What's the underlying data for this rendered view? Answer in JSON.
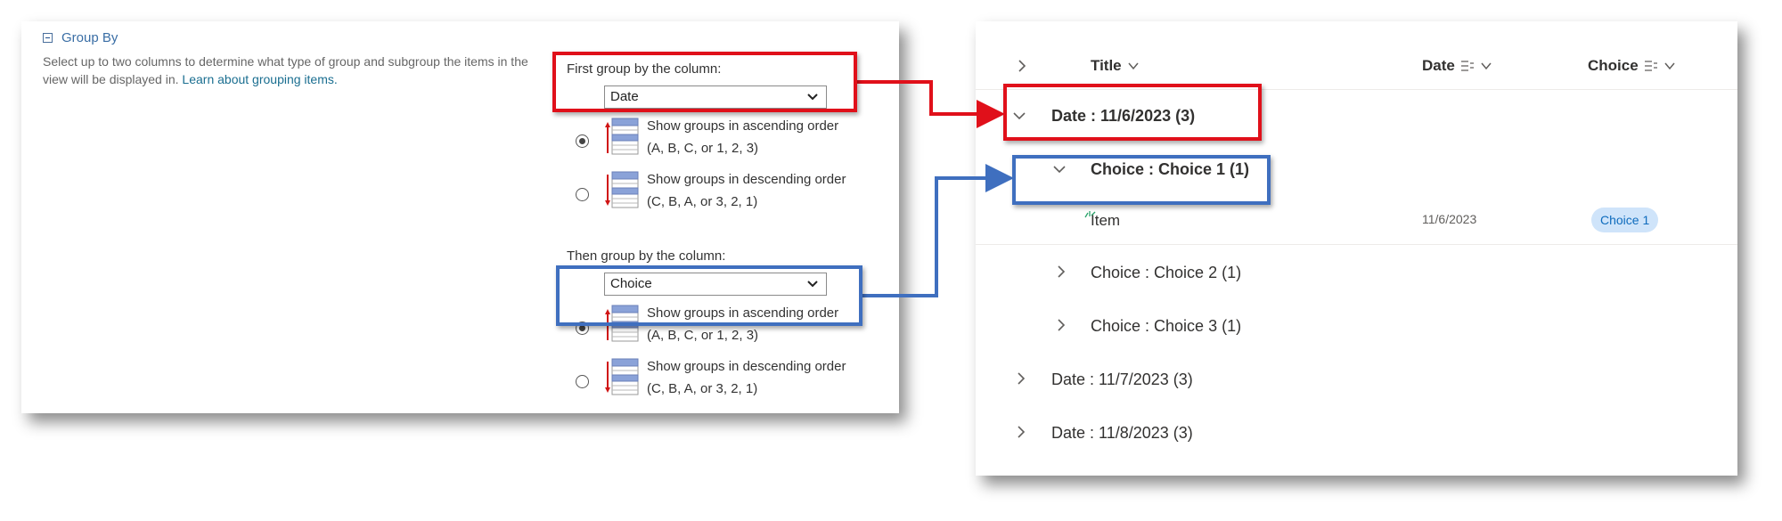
{
  "group_by": {
    "title": "Group By",
    "description": "Select up to two columns to determine what type of group and subgroup the items in the view will be displayed in.",
    "learn_link": "Learn about grouping items.",
    "first": {
      "label": "First group by the column:",
      "selected": "Date",
      "asc_line1": "Show groups in ascending order",
      "asc_line2": "(A, B, C, or 1, 2, 3)",
      "desc_line1": "Show groups in descending order",
      "desc_line2": "(C, B, A, or 3, 2, 1)"
    },
    "second": {
      "label": "Then group by the column:",
      "selected": "Choice",
      "asc_line1": "Show groups in ascending order",
      "asc_line2": "(A, B, C, or 1, 2, 3)",
      "desc_line1": "Show groups in descending order",
      "desc_line2": "(C, B, A, or 3, 2, 1)"
    }
  },
  "list": {
    "columns": {
      "title": "Title",
      "date": "Date",
      "choice": "Choice"
    },
    "groups": {
      "g1": "Date : 11/6/2023 (3)",
      "g1_sub1": "Choice : Choice 1 (1)",
      "item_title": "Item",
      "item_date": "11/6/2023",
      "item_choice": "Choice 1",
      "g1_sub2": "Choice : Choice 2 (1)",
      "g1_sub3": "Choice : Choice 3 (1)",
      "g2": "Date : 11/7/2023 (3)",
      "g3": "Date : 11/8/2023 (3)"
    }
  },
  "colors": {
    "highlight_red": "#e0101a",
    "highlight_blue": "#3f6fbf",
    "link": "#1a6e90",
    "pill_bg": "#cfe4fa",
    "pill_text": "#0f6cbd"
  }
}
